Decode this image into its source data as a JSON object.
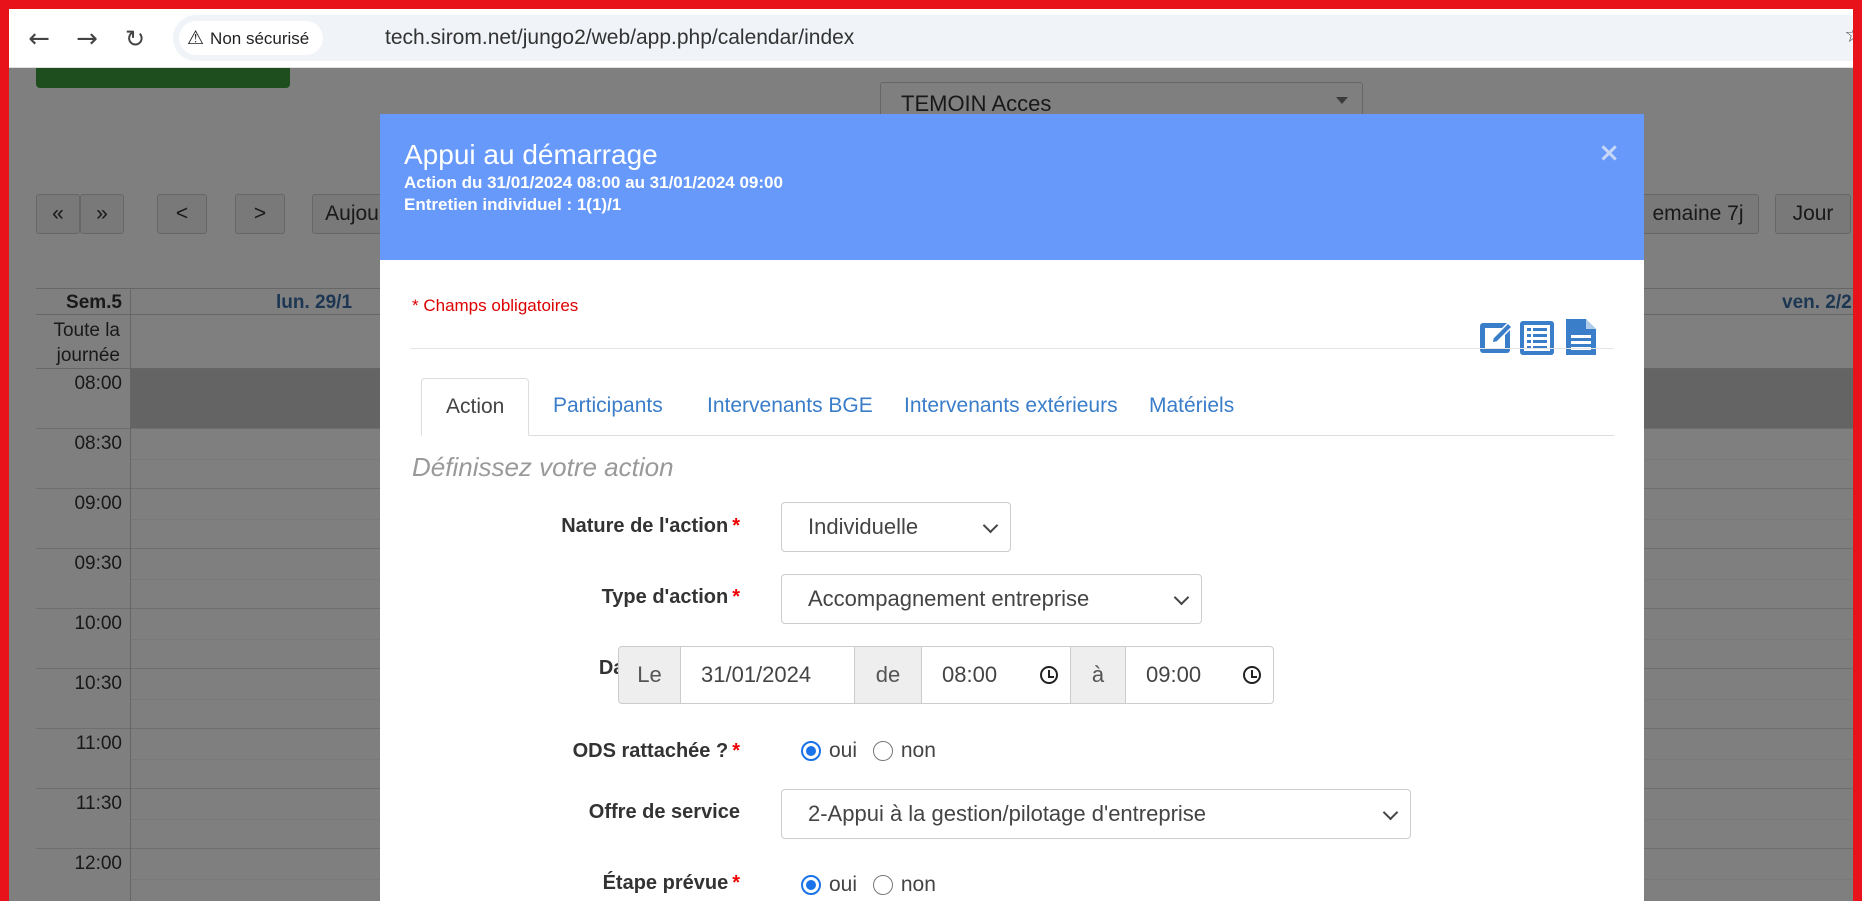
{
  "browser": {
    "security_label": "Non sécurisé",
    "url": "tech.sirom.net/jungo2/web/app.php/calendar/index"
  },
  "background": {
    "selector_value": "TEMOIN Acces",
    "toolbar": {
      "prev_prev": "«",
      "next_next": "»",
      "prev": "<",
      "next": ">",
      "today": "Aujou",
      "week7": "emaine 7j",
      "day": "Jour"
    },
    "calendar": {
      "week_label": "Sem.5",
      "day_headers": [
        "lun. 29/1",
        "ven. 2/2"
      ],
      "allday_label": "Toute la journée",
      "hours": [
        "08:00",
        "08:30",
        "09:00",
        "09:30",
        "10:00",
        "10:30",
        "11:00",
        "11:30",
        "12:00"
      ]
    }
  },
  "modal": {
    "title": "Appui au démarrage",
    "subtitle_line1": "Action du 31/01/2024 08:00 au 31/01/2024 09:00",
    "subtitle_line2": "Entretien individuel : 1(1)/1",
    "close_symbol": "×",
    "required_note": "* Champs obligatoires",
    "tabs": [
      "Action",
      "Participants",
      "Intervenants BGE",
      "Intervenants extérieurs",
      "Matériels"
    ],
    "legend": "Définissez votre action",
    "form": {
      "nature_label": "Nature de l'action",
      "nature_value": "Individuelle",
      "type_label": "Type d'action",
      "type_value": "Accompagnement entreprise",
      "date_label": "Date",
      "date_prefix": "Le",
      "date_value": "31/01/2024",
      "from_label": "de",
      "from_value": "08:00",
      "to_label": "à",
      "to_value": "09:00",
      "ods_label": "ODS rattachée ?",
      "offre_label": "Offre de service",
      "offre_value": "2-Appui à la gestion/pilotage d'entreprise",
      "etape_label": "Étape prévue",
      "yes": "oui",
      "no": "non",
      "required_mark": "*"
    }
  },
  "colors": {
    "modal_header": "#6699f9",
    "frame": "#e8121b",
    "link": "#3a7dc9",
    "radio_accent": "#1a73e8",
    "icon_blue": "#3a7dc9"
  }
}
